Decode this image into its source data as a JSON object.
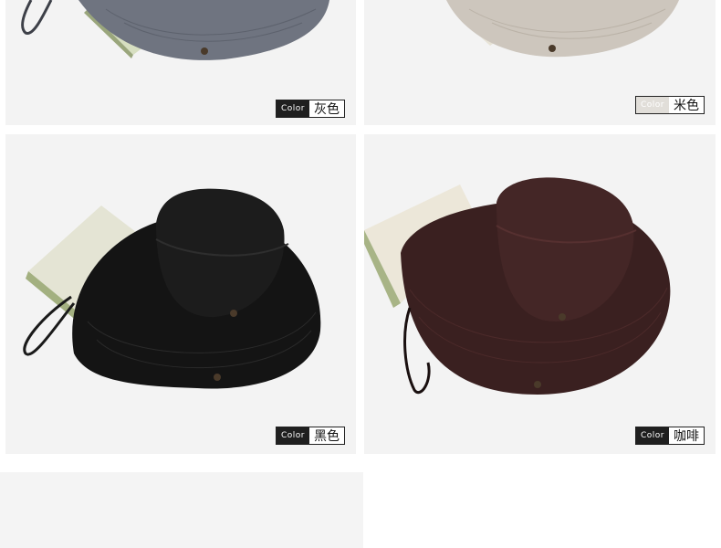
{
  "labels": {
    "color_tag": "Color",
    "gray": "灰色",
    "beige": "米色",
    "black": "黑色",
    "coffee": "咖啡"
  },
  "colors": {
    "gray_hat": "#6f7480",
    "beige_hat": "#cdc6bd",
    "black_hat": "#141414",
    "coffee_hat": "#3a2020",
    "background": "#f3f3f3"
  }
}
